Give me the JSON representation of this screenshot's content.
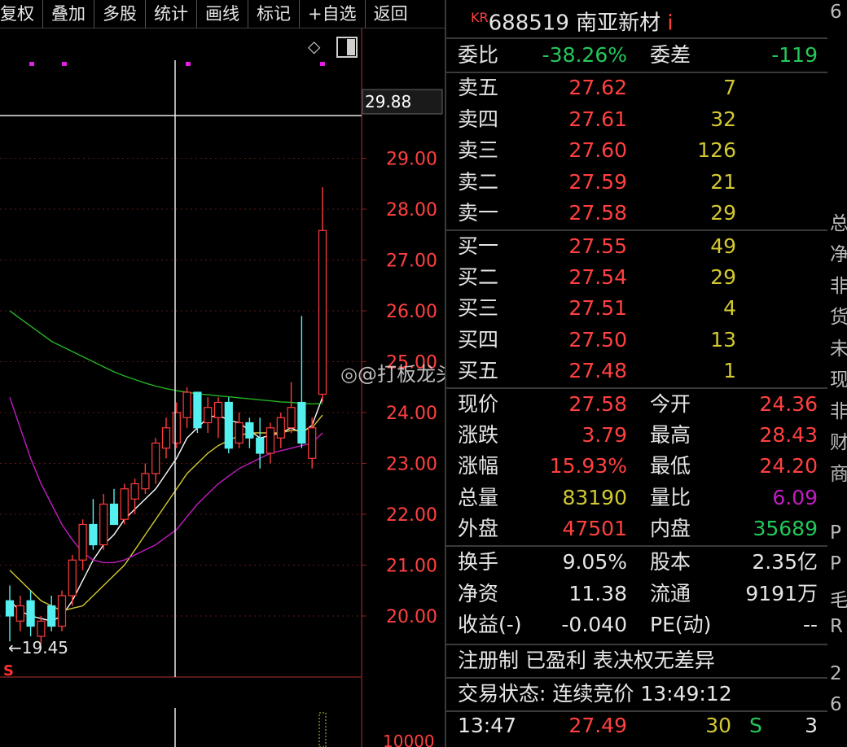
{
  "toolbar": {
    "items": [
      "复权",
      "叠加",
      "多股",
      "统计",
      "画线",
      "标记",
      "+自选",
      "返回"
    ]
  },
  "chart": {
    "crosshair_price": "29.88",
    "price_ticks": [
      "29.00",
      "28.00",
      "27.00",
      "26.00",
      "25.00",
      "24.00",
      "23.00",
      "22.00",
      "21.00",
      "20.00"
    ],
    "low_label": "←19.45",
    "volume_tick": "10000",
    "s_marker": "S"
  },
  "chart_data": {
    "type": "candlestick",
    "ylim": [
      19.4,
      29.88
    ],
    "candles": [
      {
        "o": 20.3,
        "h": 20.6,
        "l": 19.5,
        "c": 20.0
      },
      {
        "o": 19.9,
        "h": 20.4,
        "l": 19.7,
        "c": 20.2
      },
      {
        "o": 20.3,
        "h": 20.5,
        "l": 19.6,
        "c": 19.8
      },
      {
        "o": 19.6,
        "h": 20.0,
        "l": 19.45,
        "c": 19.9
      },
      {
        "o": 20.2,
        "h": 20.4,
        "l": 19.7,
        "c": 19.8
      },
      {
        "o": 19.8,
        "h": 20.5,
        "l": 19.7,
        "c": 20.4
      },
      {
        "o": 20.4,
        "h": 21.2,
        "l": 20.2,
        "c": 21.1
      },
      {
        "o": 21.1,
        "h": 21.9,
        "l": 20.9,
        "c": 21.8
      },
      {
        "o": 21.8,
        "h": 22.3,
        "l": 21.3,
        "c": 21.4
      },
      {
        "o": 21.4,
        "h": 22.4,
        "l": 21.3,
        "c": 22.2
      },
      {
        "o": 22.2,
        "h": 22.5,
        "l": 21.8,
        "c": 21.8
      },
      {
        "o": 21.9,
        "h": 22.6,
        "l": 21.8,
        "c": 22.5
      },
      {
        "o": 22.3,
        "h": 22.7,
        "l": 22.0,
        "c": 22.6
      },
      {
        "o": 22.5,
        "h": 23.0,
        "l": 22.4,
        "c": 22.8
      },
      {
        "o": 22.8,
        "h": 23.5,
        "l": 22.6,
        "c": 23.4
      },
      {
        "o": 23.3,
        "h": 23.9,
        "l": 23.1,
        "c": 23.7
      },
      {
        "o": 23.4,
        "h": 24.2,
        "l": 23.3,
        "c": 24.0
      },
      {
        "o": 23.9,
        "h": 24.5,
        "l": 23.7,
        "c": 24.4
      },
      {
        "o": 24.4,
        "h": 24.4,
        "l": 23.6,
        "c": 23.7
      },
      {
        "o": 23.8,
        "h": 24.3,
        "l": 23.6,
        "c": 24.1
      },
      {
        "o": 23.9,
        "h": 24.3,
        "l": 23.5,
        "c": 24.2
      },
      {
        "o": 24.2,
        "h": 24.3,
        "l": 23.2,
        "c": 23.3
      },
      {
        "o": 23.4,
        "h": 24.0,
        "l": 23.3,
        "c": 23.8
      },
      {
        "o": 23.8,
        "h": 23.9,
        "l": 23.3,
        "c": 23.5
      },
      {
        "o": 23.5,
        "h": 23.9,
        "l": 22.9,
        "c": 23.2
      },
      {
        "o": 23.2,
        "h": 23.8,
        "l": 23.0,
        "c": 23.7
      },
      {
        "o": 23.5,
        "h": 24.0,
        "l": 23.3,
        "c": 23.9
      },
      {
        "o": 23.7,
        "h": 24.6,
        "l": 23.6,
        "c": 24.1
      },
      {
        "o": 24.2,
        "h": 25.9,
        "l": 23.3,
        "c": 23.4
      },
      {
        "o": 23.1,
        "h": 23.9,
        "l": 22.9,
        "c": 23.7
      },
      {
        "o": 24.36,
        "h": 28.43,
        "l": 24.2,
        "c": 27.58
      }
    ],
    "ma": [
      {
        "color": "#ffffff",
        "values": [
          20.3,
          20.1,
          20.0,
          19.95,
          19.9,
          20.0,
          20.3,
          20.7,
          21.1,
          21.4,
          21.6,
          21.9,
          22.1,
          22.3,
          22.5,
          22.8,
          23.1,
          23.5,
          23.7,
          23.9,
          23.95,
          23.85,
          23.8,
          23.65,
          23.5,
          23.55,
          23.6,
          23.7,
          23.6,
          23.75,
          24.3
        ]
      },
      {
        "color": "#d2c832",
        "values": [
          20.9,
          20.7,
          20.5,
          20.3,
          20.2,
          20.1,
          20.15,
          20.2,
          20.4,
          20.6,
          20.8,
          21.0,
          21.3,
          21.6,
          21.9,
          22.2,
          22.5,
          22.8,
          23.0,
          23.2,
          23.35,
          23.45,
          23.55,
          23.6,
          23.6,
          23.6,
          23.6,
          23.65,
          23.65,
          23.7,
          23.95
        ]
      },
      {
        "color": "#c01cc0",
        "values": [
          24.3,
          23.7,
          23.1,
          22.6,
          22.2,
          21.8,
          21.5,
          21.25,
          21.1,
          21.05,
          21.05,
          21.1,
          21.2,
          21.3,
          21.4,
          21.55,
          21.7,
          21.95,
          22.2,
          22.4,
          22.6,
          22.75,
          22.9,
          23.0,
          23.1,
          23.2,
          23.25,
          23.3,
          23.35,
          23.4,
          23.6
        ]
      },
      {
        "color": "#23b423",
        "values": [
          26.0,
          25.85,
          25.7,
          25.55,
          25.4,
          25.3,
          25.2,
          25.1,
          25.0,
          24.9,
          24.8,
          24.72,
          24.65,
          24.58,
          24.52,
          24.47,
          24.43,
          24.4,
          24.37,
          24.35,
          24.33,
          24.31,
          24.29,
          24.27,
          24.25,
          24.23,
          24.21,
          24.2,
          24.18,
          24.17,
          24.18
        ]
      }
    ]
  },
  "panel": {
    "title": {
      "prefix": "KR",
      "code": "688519",
      "name": "南亚新材",
      "suffix": "i"
    },
    "weibi_label": "委比",
    "weibi_value": "-38.26%",
    "weicha_label": "委差",
    "weicha_value": "-119",
    "sell": [
      {
        "label": "卖五",
        "price": "27.62",
        "vol": "7"
      },
      {
        "label": "卖四",
        "price": "27.61",
        "vol": "32"
      },
      {
        "label": "卖三",
        "price": "27.60",
        "vol": "126"
      },
      {
        "label": "卖二",
        "price": "27.59",
        "vol": "21"
      },
      {
        "label": "卖一",
        "price": "27.58",
        "vol": "29"
      }
    ],
    "buy": [
      {
        "label": "买一",
        "price": "27.55",
        "vol": "49"
      },
      {
        "label": "买二",
        "price": "27.54",
        "vol": "29"
      },
      {
        "label": "买三",
        "price": "27.51",
        "vol": "4"
      },
      {
        "label": "买四",
        "price": "27.50",
        "vol": "13"
      },
      {
        "label": "买五",
        "price": "27.48",
        "vol": "1"
      }
    ],
    "stats": [
      {
        "l1": "现价",
        "v1": "27.58",
        "c1": "red",
        "l2": "今开",
        "v2": "24.36",
        "c2": "red"
      },
      {
        "l1": "涨跌",
        "v1": "3.79",
        "c1": "red",
        "l2": "最高",
        "v2": "28.43",
        "c2": "red"
      },
      {
        "l1": "涨幅",
        "v1": "15.93%",
        "c1": "red",
        "l2": "最低",
        "v2": "24.20",
        "c2": "red"
      },
      {
        "l1": "总量",
        "v1": "83190",
        "c1": "yellow",
        "l2": "量比",
        "v2": "6.09",
        "c2": "purple"
      },
      {
        "l1": "外盘",
        "v1": "47501",
        "c1": "red",
        "l2": "内盘",
        "v2": "35689",
        "c2": "green"
      }
    ],
    "info": [
      {
        "l1": "换手",
        "v1": "9.05%",
        "l2": "股本",
        "v2": "2.35亿"
      },
      {
        "l1": "净资",
        "v1": "11.38",
        "l2": "流通",
        "v2": "9191万"
      },
      {
        "l1": "收益(-)",
        "v1": "-0.040",
        "l2": "PE(动)",
        "v2": "--"
      }
    ],
    "tags": "注册制 已盈利 表决权无差异",
    "status": "交易状态: 连续竞价 13:49:12",
    "tick": {
      "time": "13:47",
      "price": "27.49",
      "vol": "30",
      "side": "S",
      "count": "3"
    }
  },
  "edge": [
    "6",
    "总",
    "净",
    "非",
    "货",
    "未",
    "现",
    "非",
    "财",
    "商",
    "P",
    "P",
    "毛",
    "R",
    "2",
    "6"
  ],
  "watermark": "@打板龙头股"
}
